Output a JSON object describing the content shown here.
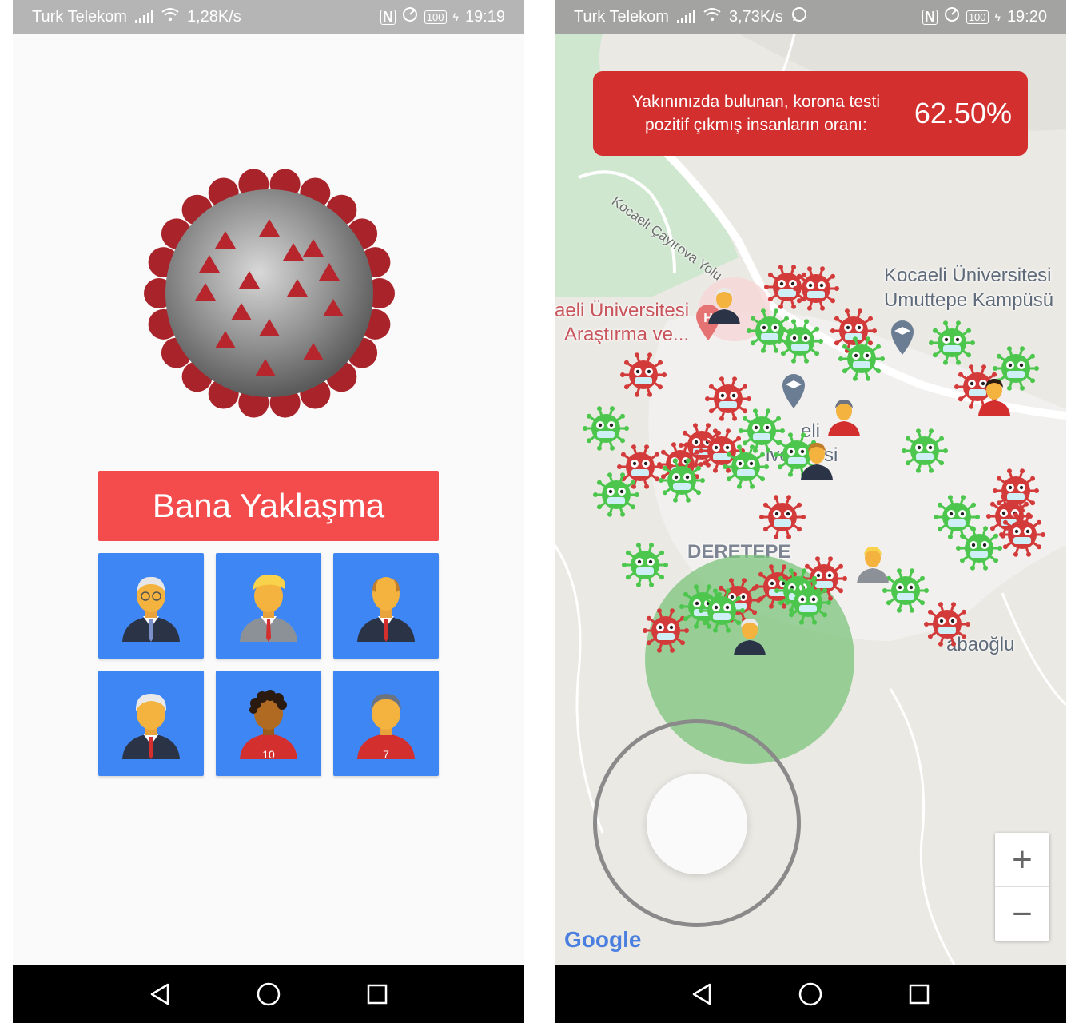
{
  "left_screen": {
    "status": {
      "carrier": "Turk Telekom",
      "speed": "1,28K/s",
      "battery": "100",
      "time": "19:19"
    },
    "button_label": "Bana Yaklaşma",
    "avatars": [
      "elder-man-avatar",
      "blonde-man-avatar",
      "bald-man-avatar",
      "grey-hair-man-avatar",
      "curly-hair-player-avatar",
      "soccer-player-avatar"
    ]
  },
  "right_screen": {
    "status": {
      "carrier": "Turk Telekom",
      "speed": "3,73K/s",
      "battery": "100",
      "time": "19:20"
    },
    "banner": {
      "text_line1": "Yakınınızda bulunan, korona testi",
      "text_line2": "pozitif çıkmış insanların oranı:",
      "value": "62.50%"
    },
    "map_labels": {
      "road": "Kocaeli Çayırova Yolu",
      "campus_line1": "Kocaeli Üniversitesi",
      "campus_line2": "Umuttepe Kampüsü",
      "hospital_line1": "aeli Üniversitesi",
      "hospital_line2": "Araştırma ve...",
      "district": "DERETEPE",
      "university_frag1": "eli",
      "university_frag2": "ive",
      "university_frag3": "si",
      "kabaoglu": "abaoğlu",
      "google": "Google"
    },
    "zoom": {
      "in": "+",
      "out": "−"
    }
  },
  "colors": {
    "accent_red": "#f44c4c",
    "banner_red": "#d32f2f",
    "tile_blue": "#3f86f5",
    "virus_red": "#d33a3a",
    "virus_green": "#4cc64c"
  }
}
